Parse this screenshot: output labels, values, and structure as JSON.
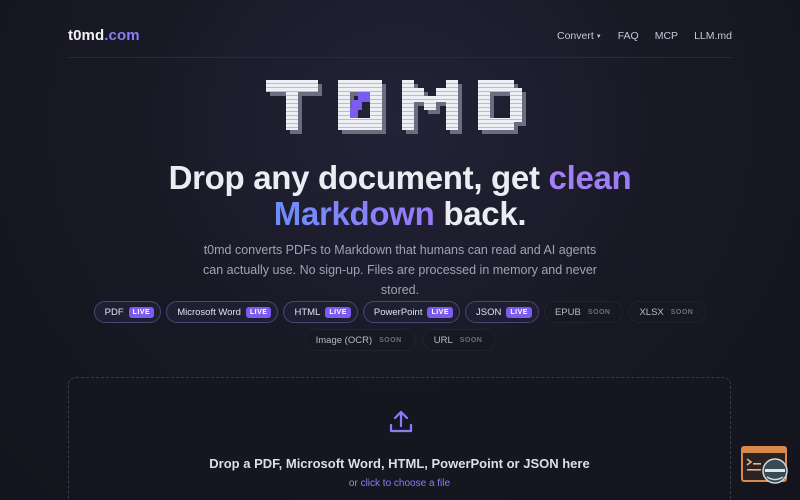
{
  "header": {
    "logo_main": "t0md",
    "logo_tld": ".com",
    "nav": {
      "convert": "Convert",
      "faq": "FAQ",
      "mcp": "MCP",
      "llm": "LLM.md"
    }
  },
  "hero": {
    "wordmark": "T0MD",
    "headline_part1": "Drop any document, get ",
    "headline_highlight1": "clean",
    "headline_highlight2": "Markdown",
    "headline_part2": " back.",
    "subtitle": "t0md converts PDFs to Markdown that humans can read and AI agents can actually use. No sign-up. Files are processed in memory and never stored."
  },
  "formats_row1": [
    {
      "label": "PDF",
      "badge": "LIVE"
    },
    {
      "label": "Microsoft Word",
      "badge": "LIVE"
    },
    {
      "label": "HTML",
      "badge": "LIVE"
    },
    {
      "label": "PowerPoint",
      "badge": "LIVE"
    },
    {
      "label": "JSON",
      "badge": "LIVE"
    },
    {
      "label": "EPUB",
      "badge": "SOON"
    },
    {
      "label": "XLSX",
      "badge": "SOON"
    }
  ],
  "formats_row2": [
    {
      "label": "Image (OCR)",
      "badge": "SOON"
    },
    {
      "label": "URL",
      "badge": "SOON"
    }
  ],
  "dropzone": {
    "title": "Drop a PDF, Microsoft Word, HTML, PowerPoint or JSON here",
    "or_text": "or ",
    "link_text": "click to choose a file"
  },
  "icons": {
    "upload": "upload-icon",
    "caret": "chevron-down-icon",
    "corner": "console-widget-icon"
  },
  "colors": {
    "accent": "#7c5cf0",
    "link": "#8e7bf6",
    "gradient_start": "#6d8dfc",
    "gradient_end": "#9a7af7",
    "background": "#191926"
  }
}
